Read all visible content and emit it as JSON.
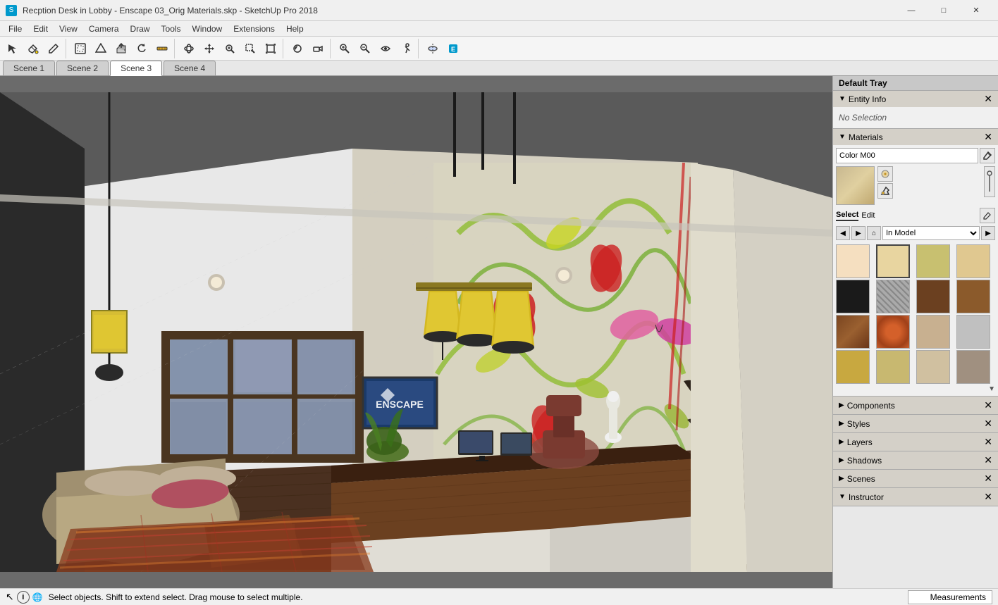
{
  "titlebar": {
    "title": "Recption Desk in Lobby - Enscape 03_Orig Materials.skp - SketchUp Pro 2018",
    "minimize": "—",
    "maximize": "□",
    "close": "✕"
  },
  "menubar": {
    "items": [
      "File",
      "Edit",
      "View",
      "Camera",
      "Draw",
      "Tools",
      "Window",
      "Extensions",
      "Help"
    ]
  },
  "tabs": {
    "items": [
      "Scene 1",
      "Scene 2",
      "Scene 3",
      "Scene 4"
    ],
    "active": 2
  },
  "right_panel": {
    "tray_title": "Default Tray",
    "entity_info": {
      "title": "Entity Info",
      "content": "No Selection"
    },
    "materials": {
      "title": "Materials",
      "name": "Color M00",
      "select_label": "Select",
      "edit_label": "Edit",
      "in_model": "In Model",
      "swatches": [
        {
          "color": "#f5dfc0",
          "label": "light peach"
        },
        {
          "color": "#e8d5a0",
          "label": "tan"
        },
        {
          "color": "#c8c070",
          "label": "yellow green"
        },
        {
          "color": "#e0c890",
          "label": "gold"
        },
        {
          "color": "#1a1a1a",
          "label": "black"
        },
        {
          "color": "#808080",
          "label": "gray pattern",
          "pattern": true
        },
        {
          "color": "#6b4020",
          "label": "dark brown"
        },
        {
          "color": "#8b5a2b",
          "label": "brown"
        },
        {
          "color": "#7a4520",
          "label": "dark wood"
        },
        {
          "color": "#d4602a",
          "label": "orange flame",
          "pattern": true
        },
        {
          "color": "#c8b090",
          "label": "light wood"
        },
        {
          "color": "#c0c0c0",
          "label": "light gray"
        },
        {
          "color": "#c8a840",
          "label": "gold yellow"
        },
        {
          "color": "#c8b870",
          "label": "olive"
        },
        {
          "color": "#d0c0a0",
          "label": "sand"
        },
        {
          "color": "#a09080",
          "label": "taupe"
        }
      ]
    },
    "collapsed_sections": [
      {
        "title": "Components",
        "expanded": false
      },
      {
        "title": "Styles",
        "expanded": false
      },
      {
        "title": "Layers",
        "expanded": false
      },
      {
        "title": "Shadows",
        "expanded": false
      },
      {
        "title": "Scenes",
        "expanded": false
      },
      {
        "title": "Instructor",
        "expanded": true
      }
    ]
  },
  "statusbar": {
    "hint": "Select objects. Shift to extend select. Drag mouse to select multiple.",
    "measurements_label": "Measurements"
  },
  "toolbar": {
    "buttons": [
      "↖",
      "✏",
      "🖊",
      "▣",
      "⬡",
      "🏗",
      "↺",
      "📐",
      "⊕",
      "✱",
      "🔑",
      "📋",
      "🔍",
      "🔎",
      "⊞",
      "🎯",
      "🔳",
      "📷",
      "🔍",
      "🔎",
      "🔬",
      "🔭",
      "👁",
      "🖱",
      "🎨"
    ]
  }
}
